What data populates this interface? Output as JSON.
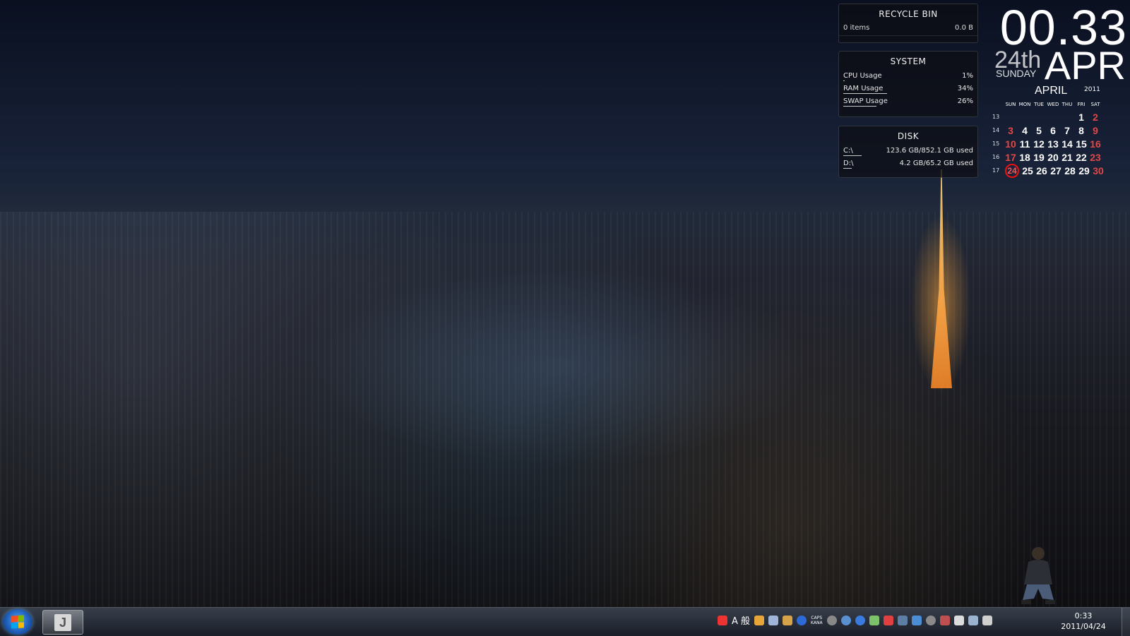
{
  "recycle_bin": {
    "title": "RECYCLE BIN",
    "items": "0 items",
    "size": "0.0 B"
  },
  "system": {
    "title": "SYSTEM",
    "rows": [
      {
        "label": "CPU Usage",
        "value": "1%",
        "fraction": 0.01
      },
      {
        "label": "RAM Usage",
        "value": "34%",
        "fraction": 0.34
      },
      {
        "label": "SWAP Usage",
        "value": "26%",
        "fraction": 0.26
      }
    ]
  },
  "disk": {
    "title": "DISK",
    "rows": [
      {
        "label": "C:\\",
        "value": "123.6 GB/852.1 GB used",
        "fraction": 0.145
      },
      {
        "label": "D:\\",
        "value": "4.2 GB/65.2 GB used",
        "fraction": 0.064
      }
    ]
  },
  "clock": {
    "time": "00.33",
    "day": "24th",
    "weekday": "SUNDAY",
    "month": "APR"
  },
  "calendar": {
    "month": "APRIL",
    "year": "2011",
    "dows": [
      "SUN",
      "MON",
      "TUE",
      "WED",
      "THU",
      "FRI",
      "SAT"
    ],
    "weeks": [
      {
        "wk": "13",
        "days": [
          "",
          "",
          "",
          "",
          "",
          "1",
          "2"
        ]
      },
      {
        "wk": "14",
        "days": [
          "3",
          "4",
          "5",
          "6",
          "7",
          "8",
          "9"
        ]
      },
      {
        "wk": "15",
        "days": [
          "10",
          "11",
          "12",
          "13",
          "14",
          "15",
          "16"
        ]
      },
      {
        "wk": "16",
        "days": [
          "17",
          "18",
          "19",
          "20",
          "21",
          "22",
          "23"
        ]
      },
      {
        "wk": "17",
        "days": [
          "24",
          "25",
          "26",
          "27",
          "28",
          "29",
          "30"
        ]
      }
    ],
    "today": "24"
  },
  "taskbar": {
    "pinned_app_label": "J",
    "tray_ime_text": "A 般",
    "caps_label": "CAPS",
    "kana_label": "KANA",
    "clock_time": "0:33",
    "clock_date": "2011/04/24"
  },
  "colors": {
    "weekend_red": "#e04848",
    "today_ring": "#e11111"
  }
}
